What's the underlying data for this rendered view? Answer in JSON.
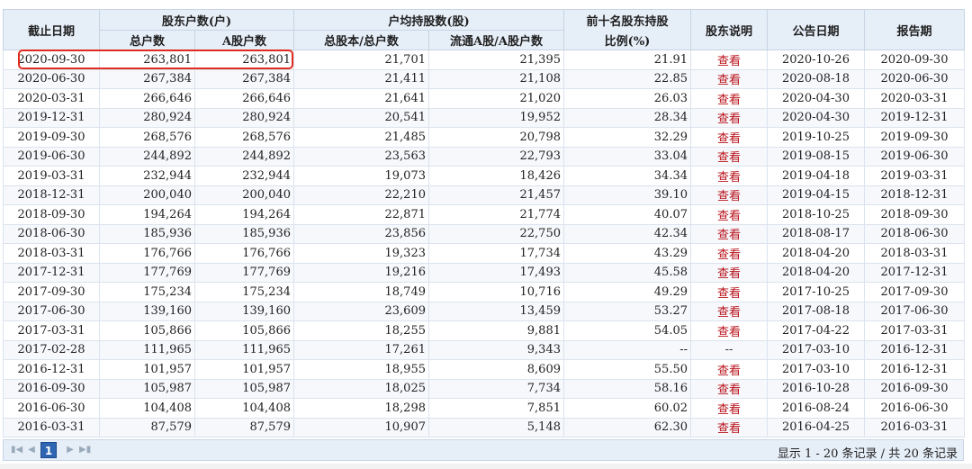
{
  "table": {
    "headers": {
      "date": "截止日期",
      "holders_group": "股东户数(户)",
      "total_holders": "总户数",
      "a_holders": "A股户数",
      "avg_group": "户均持股数(股)",
      "avg_total": "总股本/总户数",
      "avg_float": "流通A股/A股户数",
      "top10_line1": "前十名股东持股",
      "top10_line2": "比例(%)",
      "desc": "股东说明",
      "announce": "公告日期",
      "report": "报告期"
    },
    "rows": [
      [
        "2020-09-30",
        "263,801",
        "263,801",
        "21,701",
        "21,395",
        "21.91",
        "查看",
        "2020-10-26",
        "2020-09-30"
      ],
      [
        "2020-06-30",
        "267,384",
        "267,384",
        "21,411",
        "21,108",
        "22.85",
        "查看",
        "2020-08-18",
        "2020-06-30"
      ],
      [
        "2020-03-31",
        "266,646",
        "266,646",
        "21,641",
        "21,020",
        "26.03",
        "查看",
        "2020-04-30",
        "2020-03-31"
      ],
      [
        "2019-12-31",
        "280,924",
        "280,924",
        "20,541",
        "19,952",
        "28.34",
        "查看",
        "2020-04-30",
        "2019-12-31"
      ],
      [
        "2019-09-30",
        "268,576",
        "268,576",
        "21,485",
        "20,798",
        "32.29",
        "查看",
        "2019-10-25",
        "2019-09-30"
      ],
      [
        "2019-06-30",
        "244,892",
        "244,892",
        "23,563",
        "22,793",
        "33.04",
        "查看",
        "2019-08-15",
        "2019-06-30"
      ],
      [
        "2019-03-31",
        "232,944",
        "232,944",
        "19,073",
        "18,426",
        "34.34",
        "查看",
        "2019-04-18",
        "2019-03-31"
      ],
      [
        "2018-12-31",
        "200,040",
        "200,040",
        "22,210",
        "21,457",
        "39.10",
        "查看",
        "2019-04-15",
        "2018-12-31"
      ],
      [
        "2018-09-30",
        "194,264",
        "194,264",
        "22,871",
        "21,774",
        "40.07",
        "查看",
        "2018-10-25",
        "2018-09-30"
      ],
      [
        "2018-06-30",
        "185,936",
        "185,936",
        "23,856",
        "22,750",
        "42.34",
        "查看",
        "2018-08-17",
        "2018-06-30"
      ],
      [
        "2018-03-31",
        "176,766",
        "176,766",
        "19,323",
        "17,734",
        "43.29",
        "查看",
        "2018-04-20",
        "2018-03-31"
      ],
      [
        "2017-12-31",
        "177,769",
        "177,769",
        "19,216",
        "17,493",
        "45.58",
        "查看",
        "2018-04-20",
        "2017-12-31"
      ],
      [
        "2017-09-30",
        "175,234",
        "175,234",
        "18,749",
        "10,716",
        "49.29",
        "查看",
        "2017-10-25",
        "2017-09-30"
      ],
      [
        "2017-06-30",
        "139,160",
        "139,160",
        "23,609",
        "13,459",
        "53.27",
        "查看",
        "2017-08-18",
        "2017-06-30"
      ],
      [
        "2017-03-31",
        "105,866",
        "105,866",
        "18,255",
        "9,881",
        "54.05",
        "查看",
        "2017-04-22",
        "2017-03-31"
      ],
      [
        "2017-02-28",
        "111,965",
        "111,965",
        "17,261",
        "9,343",
        "--",
        "--",
        "2017-03-10",
        "2016-12-31"
      ],
      [
        "2016-12-31",
        "101,957",
        "101,957",
        "18,955",
        "8,609",
        "55.50",
        "查看",
        "2017-03-10",
        "2016-12-31"
      ],
      [
        "2016-09-30",
        "105,987",
        "105,987",
        "18,025",
        "7,734",
        "58.16",
        "查看",
        "2016-10-28",
        "2016-09-30"
      ],
      [
        "2016-06-30",
        "104,408",
        "104,408",
        "18,298",
        "7,851",
        "60.02",
        "查看",
        "2016-08-24",
        "2016-06-30"
      ],
      [
        "2016-03-31",
        "87,579",
        "87,579",
        "10,907",
        "5,148",
        "62.30",
        "查看",
        "2016-04-25",
        "2016-03-31"
      ]
    ]
  },
  "pager": {
    "first_icon": "first-page-icon",
    "prev_icon": "prev-page-icon",
    "next_icon": "next-page-icon",
    "last_icon": "last-page-icon",
    "current_page": "1",
    "info": "显示 1 - 20 条记录 / 共 20 条记录"
  },
  "colors": {
    "header_bg": "#e6eef8",
    "link": "#b8121b",
    "highlight": "#e02b1e",
    "page_button": "#2f66b3"
  }
}
